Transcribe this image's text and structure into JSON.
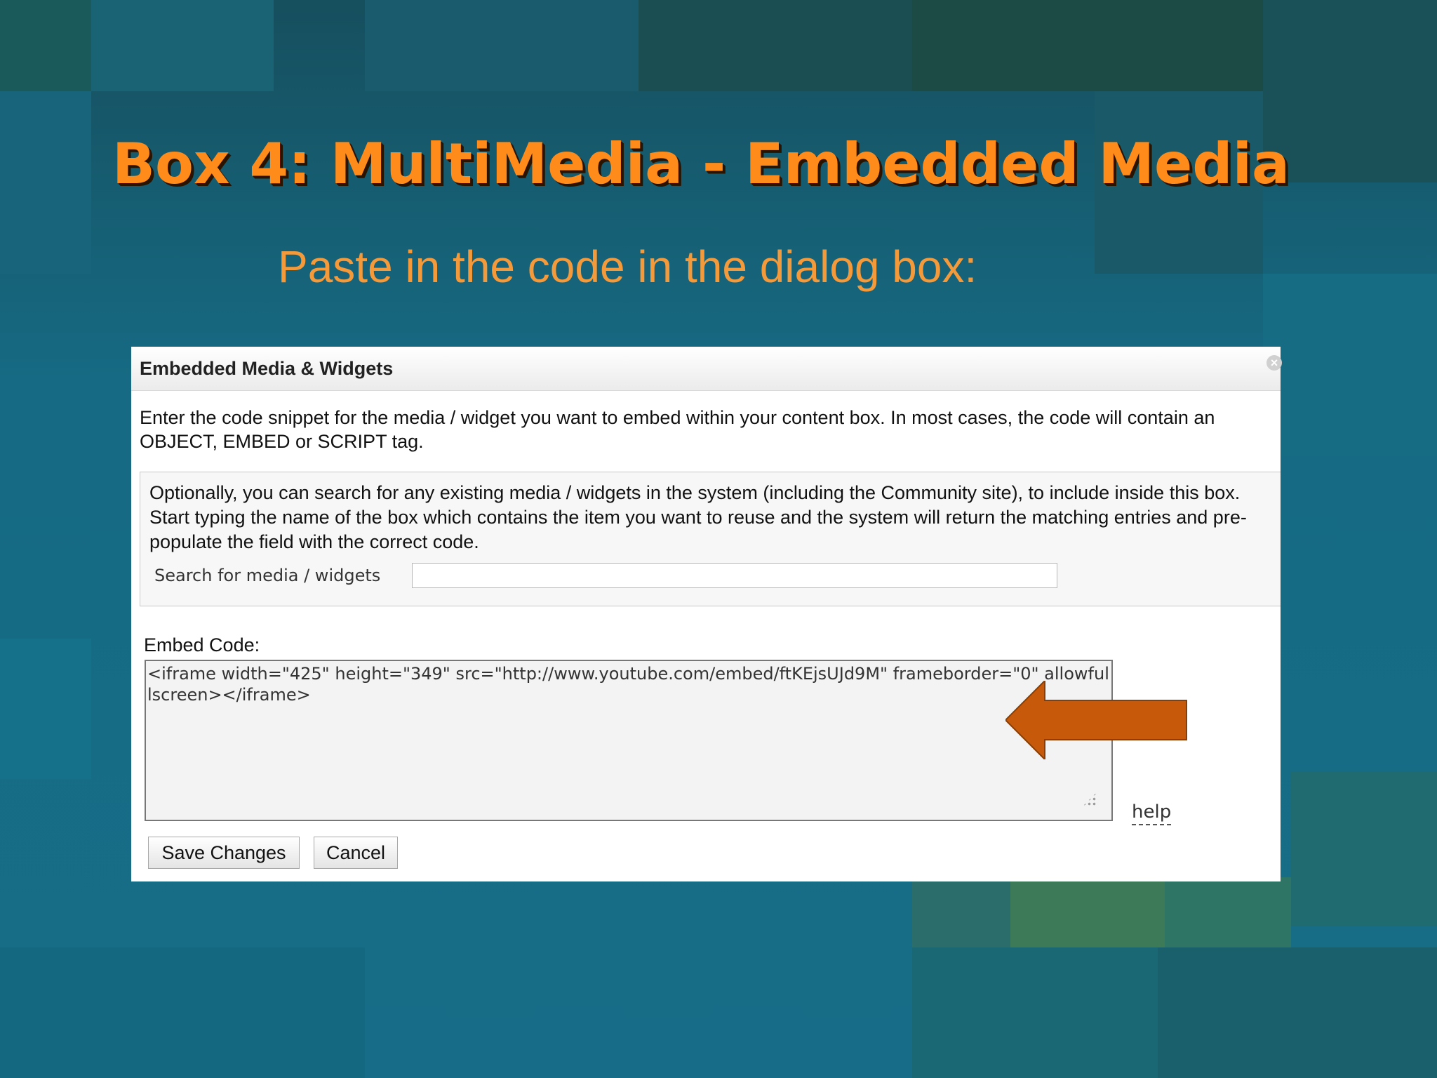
{
  "slide": {
    "title": "Box 4: MultiMedia - Embedded Media",
    "subtitle": "Paste in the code in the dialog box:"
  },
  "dialog": {
    "title": "Embedded Media & Widgets",
    "intro": "Enter the code snippet for the media / widget you want to embed within your content box. In most cases, the code will contain an OBJECT, EMBED or SCRIPT tag.",
    "search_panel": {
      "description": "Optionally, you can search for any existing media / widgets in the system (including the Community site), to include inside this box. Start typing the name of the box which contains the item you want to reuse and the system will return the matching entries and pre-populate the field with the correct code.",
      "label": "Search for media / widgets",
      "value": ""
    },
    "embed": {
      "label": "Embed Code:",
      "value": "<iframe width=\"425\" height=\"349\" src=\"http://www.youtube.com/embed/ftKEjsUJd9M\" frameborder=\"0\" allowfullscreen></iframe>"
    },
    "help_label": "help",
    "buttons": {
      "save": "Save Changes",
      "cancel": "Cancel"
    }
  },
  "icons": [
    "close-icon",
    "resize-grip-icon",
    "arrow-icon"
  ],
  "colors": {
    "title": "#ff8c1a",
    "subtitle": "#f59a3a",
    "arrow": "#c65a0a",
    "background": "#1a6a82"
  }
}
